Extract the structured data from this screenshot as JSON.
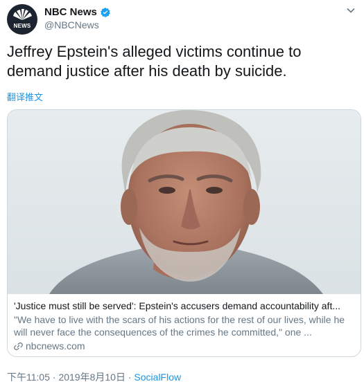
{
  "author": {
    "name": "NBC News",
    "handle": "@NBCNews",
    "avatar_text": "NEWS",
    "icons": {
      "verified": "verified-badge-icon",
      "menu": "chevron-down-icon"
    },
    "colors": {
      "verified": "#1da1f2"
    }
  },
  "tweet": {
    "text": "Jeffrey Epstein's alleged victims continue to demand justice after his death by suicide.",
    "translate_label": "翻译推文"
  },
  "card": {
    "title": "'Justice must still be served': Epstein's accusers demand accountability aft...",
    "description": "\"We have to live with the scars of his actions for the rest of our lives, while he will never face the consequences of the crimes he committed,\" one ...",
    "domain": "nbcnews.com"
  },
  "meta": {
    "time": "下午11:05",
    "separator": " · ",
    "date": "2019年8月10日",
    "source": "SocialFlow"
  }
}
